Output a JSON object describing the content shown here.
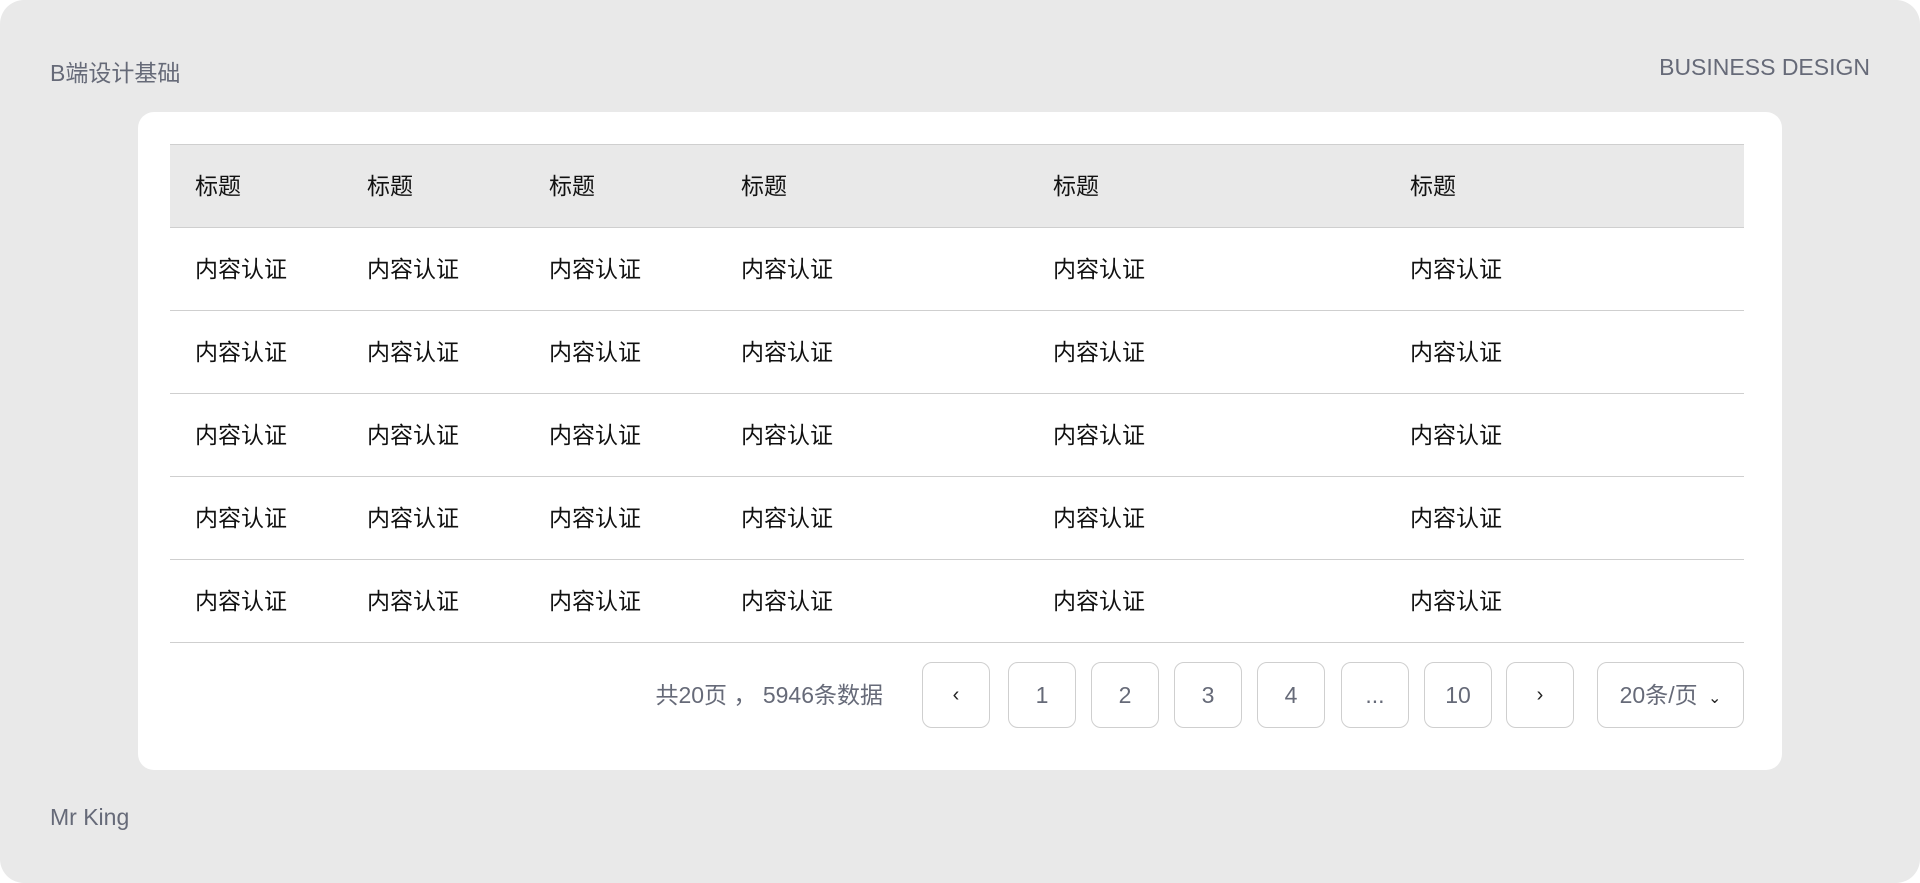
{
  "header": {
    "left": "B端设计基础",
    "right": "BUSINESS DESIGN"
  },
  "footer": {
    "author": "Mr King"
  },
  "table": {
    "columns": [
      "标题",
      "标题",
      "标题",
      "标题",
      "标题",
      "标题"
    ],
    "rows": [
      [
        "内容认证",
        "内容认证",
        "内容认证",
        "内容认证",
        "内容认证",
        "内容认证"
      ],
      [
        "内容认证",
        "内容认证",
        "内容认证",
        "内容认证",
        "内容认证",
        "内容认证"
      ],
      [
        "内容认证",
        "内容认证",
        "内容认证",
        "内容认证",
        "内容认证",
        "内容认证"
      ],
      [
        "内容认证",
        "内容认证",
        "内容认证",
        "内容认证",
        "内容认证",
        "内容认证"
      ],
      [
        "内容认证",
        "内容认证",
        "内容认证",
        "内容认证",
        "内容认证",
        "内容认证"
      ]
    ]
  },
  "pagination": {
    "summary": "共20页 ， 5946条数据",
    "prev": "‹",
    "next": "›",
    "pages": [
      "1",
      "2",
      "3",
      "4",
      "...",
      "10"
    ],
    "page_size": "20条/页",
    "dropdown": "⌄"
  }
}
